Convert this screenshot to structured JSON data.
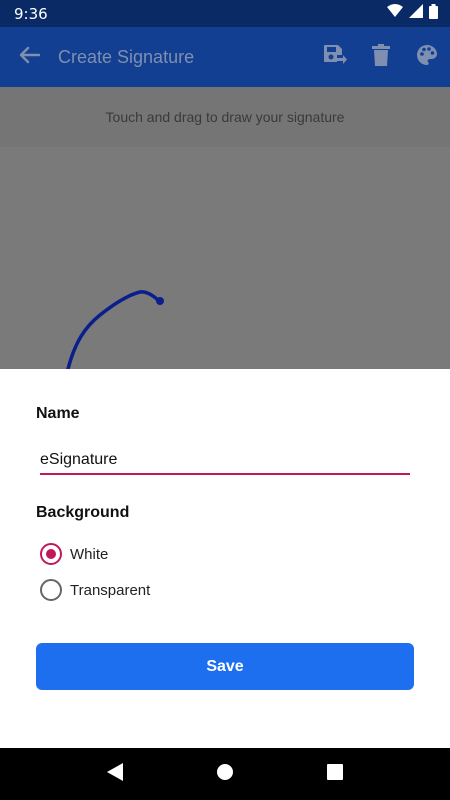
{
  "status_bar": {
    "time": "9:36"
  },
  "app_bar": {
    "title": "Create Signature"
  },
  "canvas": {
    "instruction": "Touch and drag to draw your signature"
  },
  "sheet": {
    "name_label": "Name",
    "name_value": "eSignature",
    "background_label": "Background",
    "options": [
      {
        "label": "White",
        "selected": true
      },
      {
        "label": "Transparent",
        "selected": false
      }
    ],
    "save_label": "Save"
  },
  "colors": {
    "status_bar": "#0a2a66",
    "app_bar": "#133f92",
    "accent": "#c2185b",
    "primary_button": "#1e6ff0",
    "signature_ink": "#0a1e8c"
  }
}
